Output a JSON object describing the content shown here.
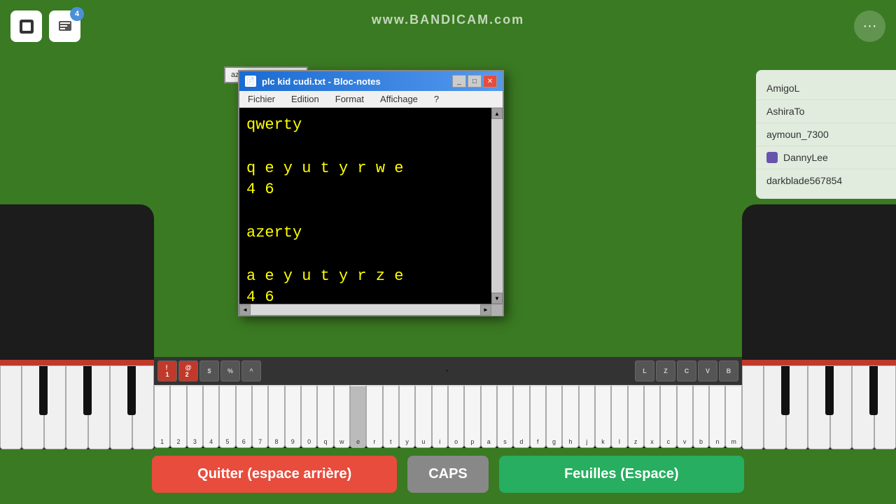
{
  "watermark": {
    "text": "www.BANDICAM.com"
  },
  "top_left": {
    "record_icon": "▶",
    "badge_icon": "📋",
    "badge_count": "4"
  },
  "top_right": {
    "menu_icon": "···"
  },
  "players": {
    "items": [
      {
        "name": "AmigoL",
        "has_icon": false
      },
      {
        "name": "AshiraTo",
        "has_icon": false
      },
      {
        "name": "aymoun_7300",
        "has_icon": false
      },
      {
        "name": "DannyLee",
        "has_icon": true
      },
      {
        "name": "darkblade567854",
        "has_icon": false
      }
    ]
  },
  "azerty_window": {
    "title": "azerty keyboard"
  },
  "notepad": {
    "title": "plc kid cudi.txt - Bloc-notes",
    "menu": [
      "Fichier",
      "Edition",
      "Format",
      "Affichage",
      "?"
    ],
    "content_line1": "qwerty",
    "content_line2": "q  e  y  u  t  y  r  w  e",
    "content_line3": "4                    6",
    "content_line4": "azerty",
    "content_line5": "a  e  y  u  t  y  r  z  e",
    "content_line6": "4                    6",
    "controls": {
      "minimize": "_",
      "maximize": "□",
      "close": "✕"
    }
  },
  "keyboard": {
    "special_keys_left": [
      "!",
      "@",
      "$",
      "%",
      "^"
    ],
    "special_keys_right": [
      "L",
      "Z",
      "C",
      "V",
      "B"
    ],
    "number_row": [
      "1",
      "2",
      "3",
      "4",
      "5",
      "6",
      "7",
      "8",
      "9",
      "0"
    ],
    "letter_row": [
      "q",
      "w",
      "e",
      "r",
      "t",
      "y",
      "u",
      "i",
      "o",
      "p",
      "a",
      "s",
      "d",
      "f",
      "g",
      "h",
      "j",
      "k",
      "l",
      "z",
      "x",
      "c",
      "v",
      "b",
      "n",
      "m"
    ],
    "active_key": "e"
  },
  "buttons": {
    "quit_label": "Quitter (espace arrière)",
    "caps_label": "CAPS",
    "leaves_label": "Feuilles (Espace)"
  }
}
